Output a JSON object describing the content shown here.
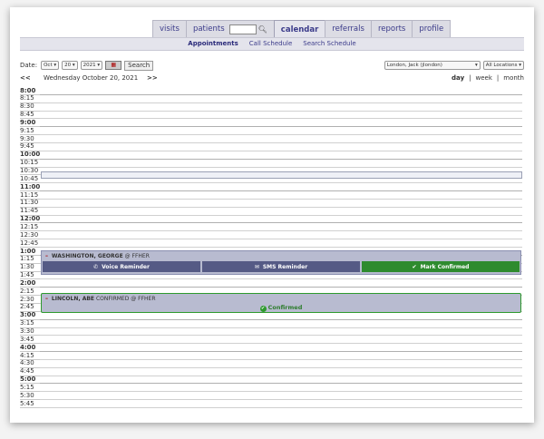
{
  "tabs": [
    {
      "label": "visits",
      "active": false
    },
    {
      "label": "patients",
      "active": false,
      "has_search": true
    },
    {
      "label": "calendar",
      "active": true
    },
    {
      "label": "referrals",
      "active": false
    },
    {
      "label": "reports",
      "active": false
    },
    {
      "label": "profile",
      "active": false
    }
  ],
  "subnav": {
    "appointments": "Appointments",
    "call_schedule": "Call Schedule",
    "search_schedule": "Search Schedule"
  },
  "date_row": {
    "label": "Date:",
    "month": "Oct",
    "day": "20",
    "year": "2021",
    "search_label": "Search",
    "provider": "London, Jack (jlondon)",
    "location": "All Locations"
  },
  "nav": {
    "prev": "<<",
    "date": "Wednesday October 20, 2021",
    "next": ">>",
    "views": [
      "day",
      "week",
      "month"
    ],
    "active_view": "day"
  },
  "times": [
    "8:00",
    "8:15",
    "8:30",
    "8:45",
    "9:00",
    "9:15",
    "9:30",
    "9:45",
    "10:00",
    "10:15",
    "10:30",
    "10:45",
    "11:00",
    "11:15",
    "11:30",
    "11:45",
    "12:00",
    "12:15",
    "12:30",
    "12:45",
    "1:00",
    "1:15",
    "1:30",
    "1:45",
    "2:00",
    "2:15",
    "2:30",
    "2:45",
    "3:00",
    "3:15",
    "3:30",
    "3:45",
    "4:00",
    "4:15",
    "4:30",
    "4:45",
    "5:00",
    "5:15",
    "5:30",
    "5:45"
  ],
  "appointments": [
    {
      "name": "WASHINGTON, GEORGE",
      "suffix": "@ FFHER",
      "actions": {
        "voice": "Voice Reminder",
        "sms": "SMS Reminder",
        "confirm": "Mark Confirmed"
      }
    },
    {
      "name": "LINCOLN, ABE",
      "suffix": "CONFIRMED @ FFHER",
      "status": "Confirmed"
    }
  ],
  "colors": {
    "tab_text": "#3b3b8a",
    "appt_bg": "#b8bbd0",
    "btn_bg": "#555a85",
    "confirm_green": "#2e8b2e"
  }
}
